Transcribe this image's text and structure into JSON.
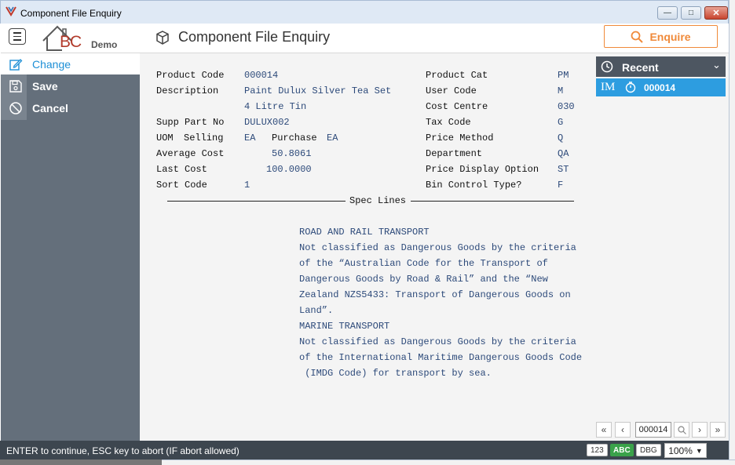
{
  "window": {
    "title": "Component File Enquiry",
    "min_glyph": "—",
    "max_glyph": "□",
    "close_glyph": "✕"
  },
  "header": {
    "logo_text": "BC",
    "logo_sub": "Demo",
    "page_title": "Component File Enquiry",
    "enquire_label": "Enquire"
  },
  "sidebar": {
    "items": [
      {
        "label": "Change",
        "icon": "edit-icon"
      },
      {
        "label": "Save",
        "icon": "save-icon"
      },
      {
        "label": "Cancel",
        "icon": "cancel-icon"
      }
    ]
  },
  "form": {
    "product_code_label": "Product Code",
    "product_code": "000014",
    "description_label": "Description",
    "description_1": "Paint Dulux Silver Tea Set",
    "description_2": "4 Litre Tin",
    "supp_part_label": "Supp Part No",
    "supp_part": "DULUX002",
    "uom_label": "UOM",
    "selling_label": "Selling",
    "selling": "EA",
    "purchase_label": "Purchase",
    "purchase": "EA",
    "avg_cost_label": "Average Cost",
    "avg_cost": "50.8061",
    "last_cost_label": "Last Cost",
    "last_cost": "100.0000",
    "sort_code_label": "Sort Code",
    "sort_code": "1",
    "product_cat_label": "Product Cat",
    "product_cat": "PM",
    "user_code_label": "User Code",
    "user_code": "M",
    "cost_centre_label": "Cost Centre",
    "cost_centre": "030",
    "tax_code_label": "Tax Code",
    "tax_code": "G",
    "price_method_label": "Price Method",
    "price_method": "Q",
    "department_label": "Department",
    "department": "QA",
    "price_display_label": "Price Display Option",
    "price_display": "ST",
    "bin_control_label": "Bin Control Type?",
    "bin_control": "F"
  },
  "spec": {
    "title": "Spec Lines",
    "lines": [
      "ROAD AND RAIL TRANSPORT",
      "Not classified as Dangerous Goods by the criteria",
      "of the “Australian Code for the Transport of",
      "Dangerous Goods by Road & Rail” and the “New",
      "Zealand NZS5433: Transport of Dangerous Goods on",
      "Land”.",
      "MARINE TRANSPORT",
      "Not classified as Dangerous Goods by the criteria",
      "of the International Maritime Dangerous Goods Code",
      " (IMDG Code) for transport by sea."
    ]
  },
  "recent": {
    "title": "Recent",
    "item_tag": "IM",
    "item_code": "000014"
  },
  "pager": {
    "value": "000014"
  },
  "status": {
    "message": "ENTER to continue, ESC key to abort (IF abort allowed)",
    "chip_123": "123",
    "chip_abc": "ABC",
    "chip_dbg": "DBG",
    "zoom": "100%"
  }
}
